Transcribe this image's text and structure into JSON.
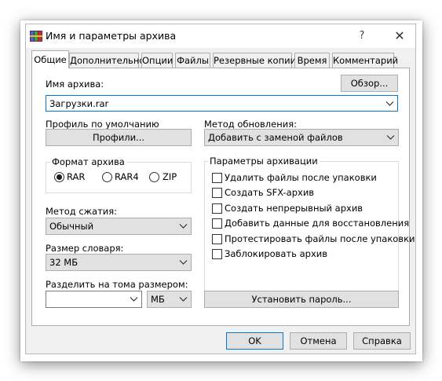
{
  "window": {
    "title": "Имя и параметры архива",
    "help_glyph": "?",
    "close_glyph": "✕"
  },
  "tabs": [
    {
      "label": "Общие",
      "active": true
    },
    {
      "label": "Дополнительно"
    },
    {
      "label": "Опции"
    },
    {
      "label": "Файлы"
    },
    {
      "label": "Резервные копии"
    },
    {
      "label": "Время"
    },
    {
      "label": "Комментарий"
    }
  ],
  "archive_name": {
    "label": "Имя архива:",
    "value": "Загрузки.rar",
    "browse_label": "Обзор..."
  },
  "profile": {
    "label": "Профиль по умолчанию",
    "button_label": "Профили..."
  },
  "update_method": {
    "label": "Метод обновления:",
    "value": "Добавить с заменой файлов"
  },
  "archive_format": {
    "title": "Формат архива",
    "options": [
      "RAR",
      "RAR4",
      "ZIP"
    ],
    "selected": "RAR"
  },
  "compression": {
    "label": "Метод сжатия:",
    "value": "Обычный"
  },
  "dictionary": {
    "label": "Размер словаря:",
    "value": "32 МБ"
  },
  "split": {
    "label": "Разделить на тома размером:",
    "value": "",
    "unit": "МБ"
  },
  "archiving_options": {
    "title": "Параметры архивации",
    "items": [
      {
        "label": "Удалить файлы после упаковки",
        "checked": false
      },
      {
        "label": "Создать SFX-архив",
        "checked": false
      },
      {
        "label": "Создать непрерывный архив",
        "checked": false
      },
      {
        "label": "Добавить данные для восстановления",
        "checked": false
      },
      {
        "label": "Протестировать файлы после упаковки",
        "checked": false
      },
      {
        "label": "Заблокировать архив",
        "checked": false
      }
    ]
  },
  "set_password_label": "Установить пароль...",
  "footer": {
    "ok": "OK",
    "cancel": "Отмена",
    "help": "Справка"
  },
  "colors": {
    "focus_border": "#0078d7",
    "button_face": "#e1e1e1",
    "dialog_bg": "#f0f0f0"
  }
}
